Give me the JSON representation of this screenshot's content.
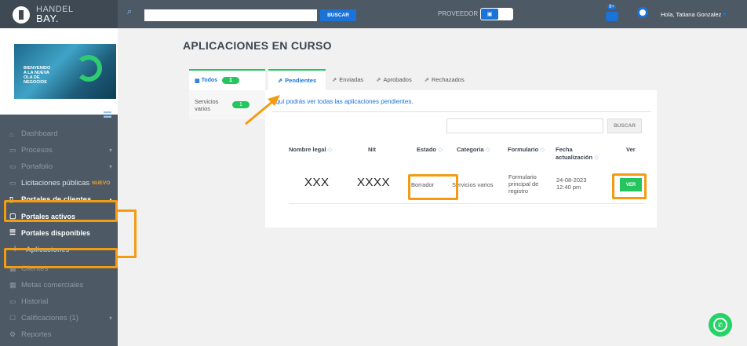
{
  "logo": {
    "line1": "HANDEL",
    "line2": "BAY."
  },
  "banner": {
    "text_line1": "BIENVENIDO",
    "text_line2": "A LA NUEVA",
    "text_line3": "OLA DE",
    "text_line4": "NEGOCIOS"
  },
  "topbar": {
    "search_button": "BUSCAR",
    "mode_label": "PROVEEDOR",
    "notification_count": "9+",
    "user_greeting": "Hola, Tatiana Gonzalez"
  },
  "sidebar": {
    "items": [
      {
        "label": "Dashboard",
        "icon": "home-icon"
      },
      {
        "label": "Procesos",
        "icon": "folder-icon"
      },
      {
        "label": "Portafolio",
        "icon": "briefcase-icon"
      },
      {
        "label": "Licitaciones públicas",
        "icon": "folder-icon",
        "badge": "NUEVO"
      },
      {
        "label": "Portales de clientes",
        "icon": "briefcase-icon"
      },
      {
        "label": "Portales activos",
        "icon": "document-icon"
      },
      {
        "label": "Portales disponibles",
        "icon": "list-icon"
      },
      {
        "label": "Aplicaciones",
        "icon": "tree-icon"
      },
      {
        "label": "Clientes",
        "icon": "building-icon"
      },
      {
        "label": "Metas comerciales",
        "icon": "chart-icon"
      },
      {
        "label": "Historial",
        "icon": "folder-icon"
      },
      {
        "label": "Calificaciones (1)",
        "icon": "square-icon"
      },
      {
        "label": "Reportes",
        "icon": "gear-icon"
      }
    ]
  },
  "main": {
    "title": "APLICACIONES EN CURSO",
    "filter": {
      "all_label": "Todos",
      "all_count": "1",
      "category_label": "Servicios varios",
      "category_count": "1"
    },
    "tabs": [
      {
        "label": "Pendientes"
      },
      {
        "label": "Enviadas"
      },
      {
        "label": "Aprobados"
      },
      {
        "label": "Rechazados"
      }
    ],
    "description": "Aquí podrás ver todas las aplicaciones pendientes.",
    "table_search_button": "BUSCAR",
    "columns": {
      "nombre": "Nombre legal",
      "nit": "Nit",
      "estado": "Estado",
      "categoria": "Categoria",
      "formulario": "Formulario",
      "fecha_1": "Fecha",
      "fecha_2": "actualización",
      "ver": "Ver"
    },
    "row": {
      "nombre": "XXX",
      "nit": "XXXX",
      "estado": "Borrador",
      "categoria": "Servicios varios",
      "formulario_1": "Formulario",
      "formulario_2": "principal de",
      "formulario_3": "registro",
      "fecha_1": "24-08-2023",
      "fecha_2": "12:40 pm",
      "ver_button": "VER"
    }
  },
  "colors": {
    "accent": "#1a73d9",
    "green": "#24c55e",
    "annotation": "#f39c12",
    "sidebar": "#4d5965"
  }
}
